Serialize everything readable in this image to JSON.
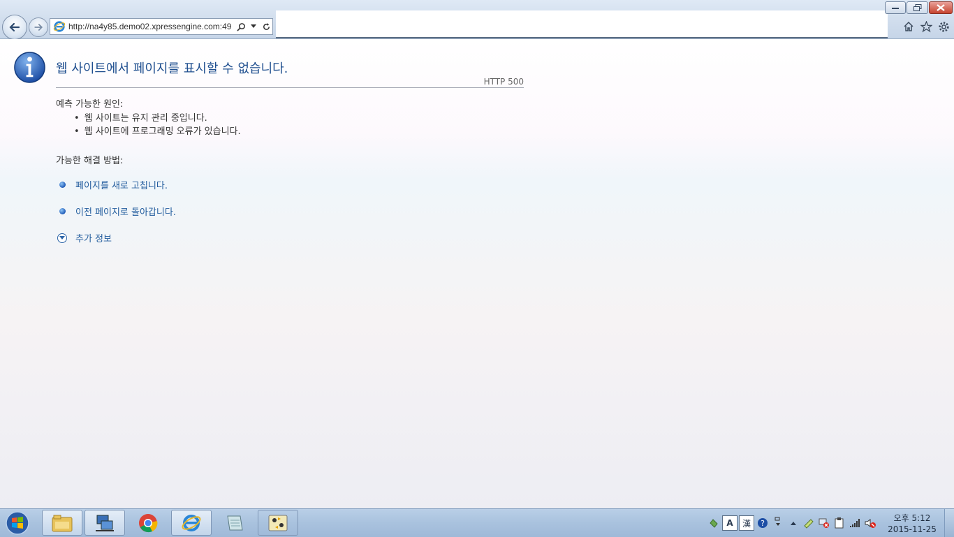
{
  "browser": {
    "url": "http://na4y85.demo02.xpressengine.com:49"
  },
  "error": {
    "title": "웹 사이트에서 페이지를 표시할 수 없습니다.",
    "code": "HTTP 500",
    "causes_label": "예측 가능한 원인:",
    "causes": [
      "웹 사이트는 유지 관리 중입니다.",
      "웹 사이트에 프로그래밍 오류가 있습니다."
    ],
    "solutions_label": "가능한 해결 방법:",
    "solutions": [
      "페이지를 새로 고칩니다.",
      "이전 페이지로 돌아갑니다."
    ],
    "more_info": "추가 정보"
  },
  "taskbar": {
    "clock_time": "오후 5:12",
    "clock_date": "2015-11-25",
    "ime_mode": "A",
    "ime_hanja": "漢"
  },
  "colors": {
    "link": "#1f5a9c",
    "title": "#1f4f8f",
    "taskbar": "#a9c2de"
  }
}
